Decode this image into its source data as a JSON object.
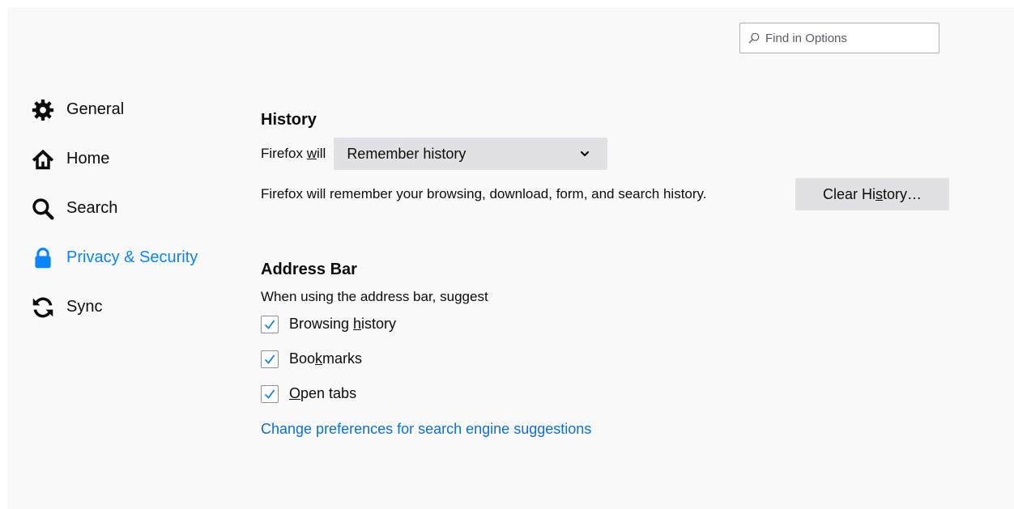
{
  "search": {
    "placeholder": "Find in Options",
    "value": ""
  },
  "sidebar": {
    "items": [
      {
        "label": "General",
        "icon": "gear-icon",
        "selected": false
      },
      {
        "label": "Home",
        "icon": "home-icon",
        "selected": false
      },
      {
        "label": "Search",
        "icon": "search-icon",
        "selected": false
      },
      {
        "label": "Privacy & Security",
        "icon": "lock-icon",
        "selected": true
      },
      {
        "label": "Sync",
        "icon": "sync-icon",
        "selected": false
      }
    ]
  },
  "history": {
    "title": "History",
    "firefox_will_pre": "Firefox ",
    "firefox_will_accesskey": "w",
    "firefox_will_post": "ill",
    "dropdown_value": "Remember history",
    "description": "Firefox will remember your browsing, download, form, and search history.",
    "clear_button_pre": "Clear Hi",
    "clear_button_accesskey": "s",
    "clear_button_post": "tory…"
  },
  "address_bar": {
    "title": "Address Bar",
    "subtitle": "When using the address bar, suggest",
    "options": [
      {
        "pre": "Browsing ",
        "accesskey": "h",
        "post": "istory",
        "checked": true
      },
      {
        "pre": "Boo",
        "accesskey": "k",
        "post": "marks",
        "checked": true
      },
      {
        "pre": "",
        "accesskey": "O",
        "post": "pen tabs",
        "checked": true
      }
    ],
    "link": "Change preferences for search engine suggestions"
  },
  "colors": {
    "accent": "#0a84ff",
    "link": "#0a70d6",
    "background": "#f9f9fa",
    "button": "#e1e1e3"
  }
}
